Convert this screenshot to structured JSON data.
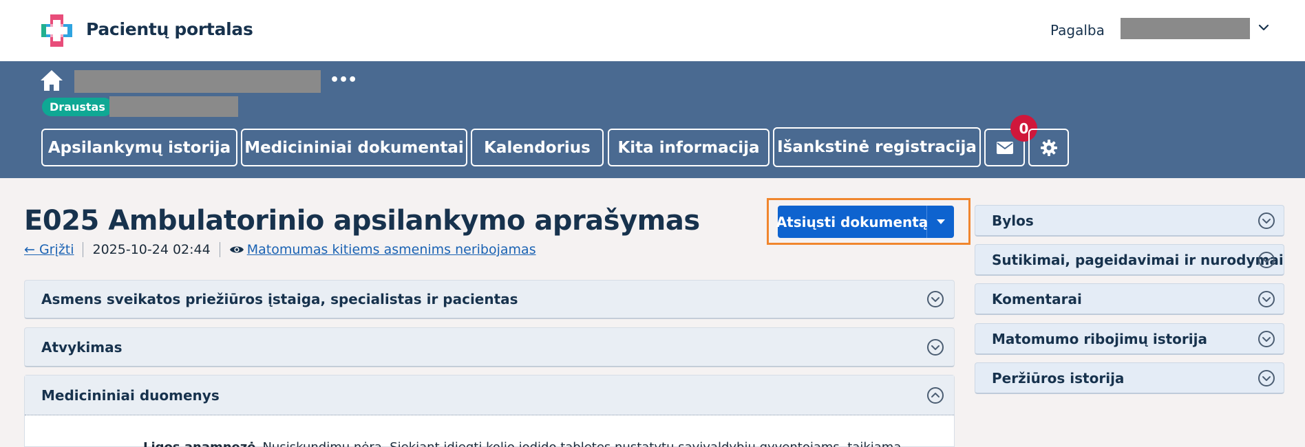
{
  "header": {
    "brand": "Pacientų portalas",
    "help_label": "Pagalba"
  },
  "breadcrumb": {
    "more": "•••"
  },
  "user_role_badge": "Draustas",
  "nav": {
    "tabs": [
      {
        "label": "Apsilankymų istorija"
      },
      {
        "label": "Medicininiai dokumentai"
      },
      {
        "label": "Kalendorius"
      },
      {
        "label": "Kita informacija"
      },
      {
        "label": "Išankstinė registracija"
      }
    ],
    "message_count": "0"
  },
  "document": {
    "title": "E025 Ambulatorinio apsilankymo aprašymas",
    "back_label": "← Grįžti",
    "date": "2025-10-24 02:44",
    "visibility_label": "Matomumas kitiems asmenims neribojamas",
    "download_label": "Atsiųsti dokumentą"
  },
  "sections": [
    {
      "title": "Asmens sveikatos priežiūros įstaiga, specialistas ir pacientas",
      "expanded": false
    },
    {
      "title": "Atvykimas",
      "expanded": false
    },
    {
      "title": "Medicininiai duomenys",
      "expanded": true
    }
  ],
  "medical_data": {
    "field_label": "Ligos anamnezė",
    "field_value": "Nusiskundimų nėra. Siekiant įdiegti kolio jodido tabletes nustatytų savivaldybių gyventojams, taikiama"
  },
  "side_panels": [
    {
      "title": "Bylos"
    },
    {
      "title": "Sutikimai, pageidavimai ir nurodymai"
    },
    {
      "title": "Komentarai"
    },
    {
      "title": "Matomumo ribojimų istorija"
    },
    {
      "title": "Peržiūros istorija"
    }
  ],
  "colors": {
    "nav_band": "#4a6a91",
    "primary_button": "#0e63cf",
    "highlight_outline": "#f0862e",
    "badge_teal": "#0fa894",
    "notification_red": "#d0173b"
  }
}
